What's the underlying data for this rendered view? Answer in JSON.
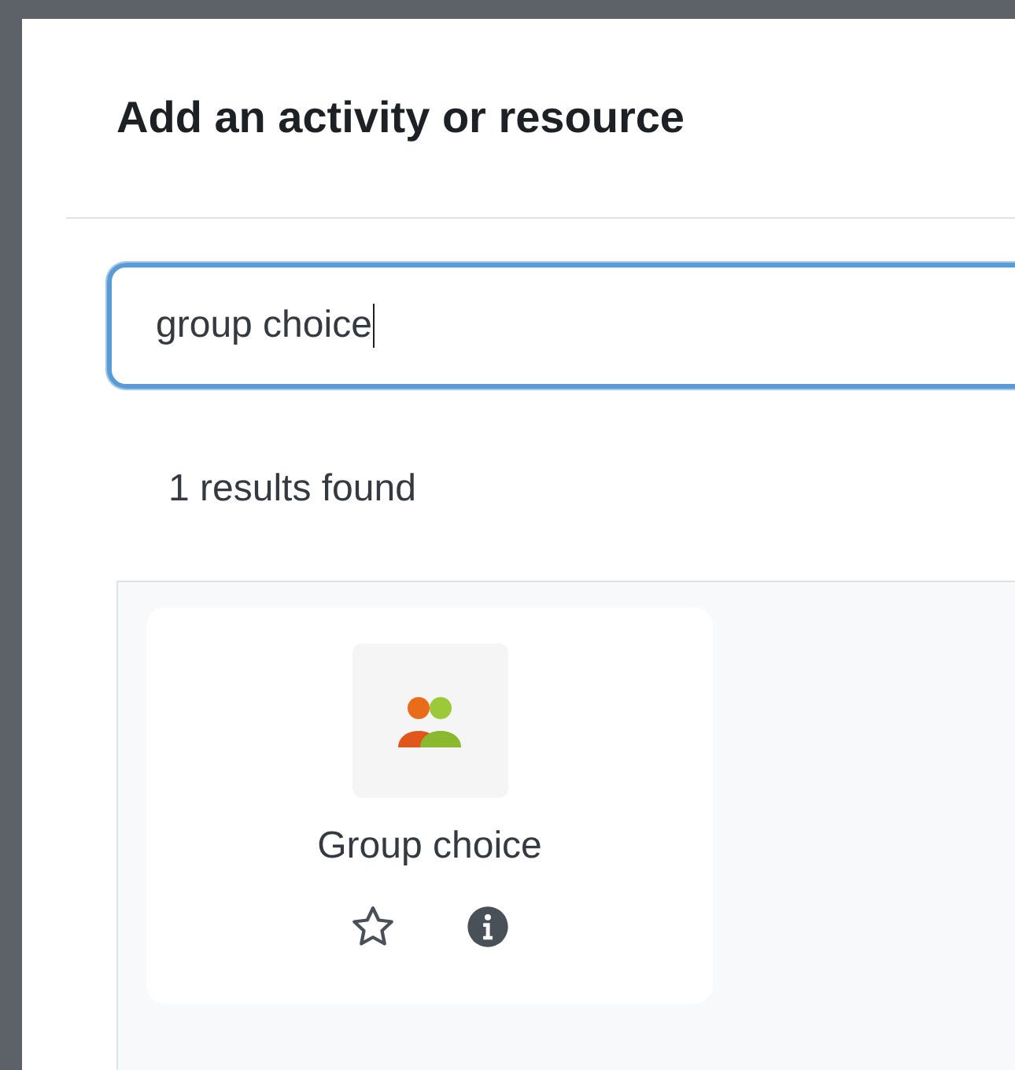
{
  "dialog": {
    "title": "Add an activity or resource"
  },
  "search": {
    "value": "group choice",
    "focused": true
  },
  "results_summary": "1 results found",
  "results": [
    {
      "name": "Group choice",
      "starred": false
    }
  ]
}
